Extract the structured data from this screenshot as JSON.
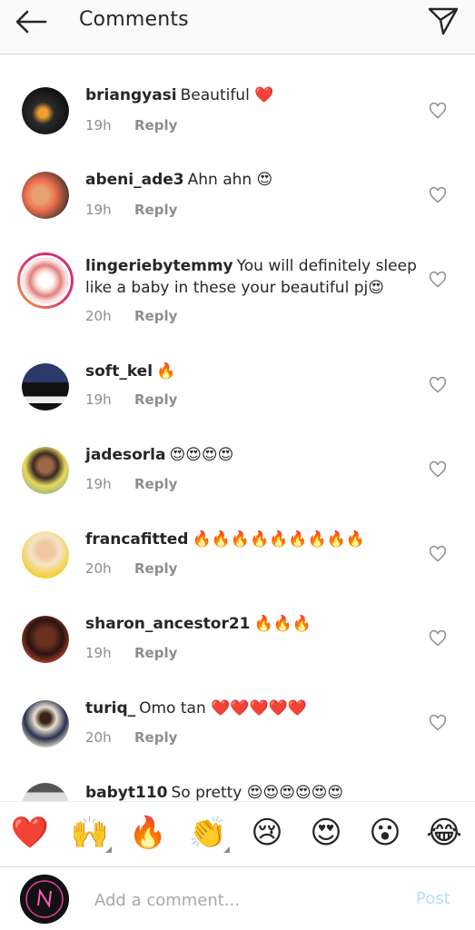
{
  "header": {
    "title": "Comments",
    "back_icon": "arrow-left-icon",
    "share_icon": "paper-plane-icon"
  },
  "comments": [
    {
      "username": "briangyasi",
      "text": "Beautiful ❤️",
      "time": "19h",
      "reply": "Reply"
    },
    {
      "username": "abeni_ade3",
      "text": "Ahn ahn 😍",
      "time": "19h",
      "reply": "Reply"
    },
    {
      "username": "lingeriebytemmy",
      "text": "You will definitely sleep like a baby in these your beautiful pj😍",
      "time": "20h",
      "reply": "Reply"
    },
    {
      "username": "soft_kel",
      "text": "🔥",
      "time": "19h",
      "reply": "Reply"
    },
    {
      "username": "jadesorla",
      "text": "😍😍😍😍",
      "time": "19h",
      "reply": "Reply"
    },
    {
      "username": "francafitted",
      "text": "🔥🔥🔥🔥🔥🔥🔥🔥🔥",
      "time": "20h",
      "reply": "Reply"
    },
    {
      "username": "sharon_ancestor21",
      "text": "🔥🔥🔥",
      "time": "19h",
      "reply": "Reply"
    },
    {
      "username": "turiq_",
      "text": "Omo tan ❤️❤️❤️❤️❤️",
      "time": "20h",
      "reply": "Reply"
    },
    {
      "username": "babyt110",
      "text": "So pretty 😍😍😍😍😍😍",
      "time": "",
      "reply": ""
    }
  ],
  "reactions": [
    "❤️",
    "🙌",
    "🔥",
    "👏",
    "😢",
    "😍",
    "😮",
    "😂"
  ],
  "composer": {
    "placeholder": "Add a comment...",
    "post_label": "Post"
  },
  "colors": {
    "text": "#262626",
    "muted": "#8e8e8e",
    "post_disabled": "#b2dffc",
    "story_ring": "#e1306c"
  }
}
